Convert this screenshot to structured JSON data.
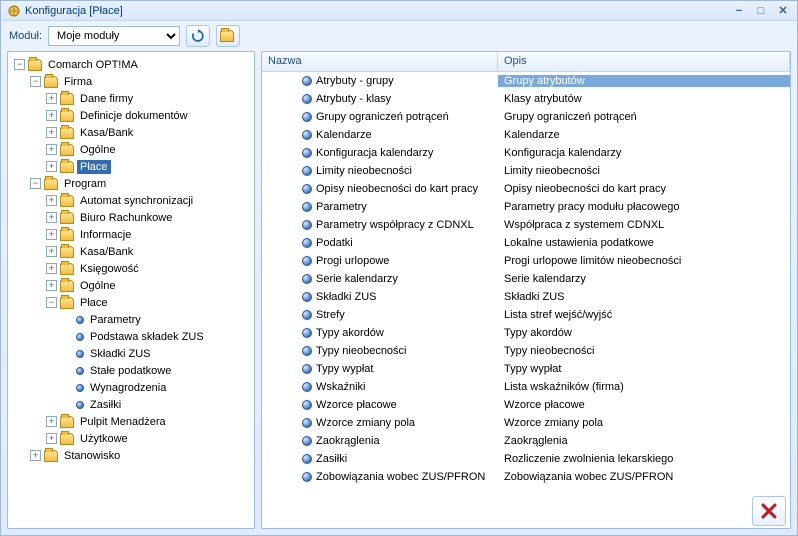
{
  "window": {
    "title": "Konfiguracja [Płace]"
  },
  "toolbar": {
    "module_label": "Moduł:",
    "module_value": "Moje moduły"
  },
  "tree": {
    "root_label": "Comarch OPT!MA",
    "firma_label": "Firma",
    "firma_children": [
      "Dane firmy",
      "Definicje dokumentów",
      "Kasa/Bank",
      "Ogólne",
      "Płace"
    ],
    "program_label": "Program",
    "program_children_before_place": [
      "Automat synchronizacji",
      "Biuro Rachunkowe",
      "Informacje",
      "Kasa/Bank",
      "Księgowość",
      "Ogólne"
    ],
    "place_label": "Płace",
    "place_children": [
      "Parametry",
      "Podstawa składek ZUS",
      "Składki ZUS",
      "Stałe podatkowe",
      "Wynagrodzenia",
      "Zasiłki"
    ],
    "program_children_after_place": [
      "Pulpit Menadżera",
      "Użytkowe"
    ],
    "stanowisko_label": "Stanowisko"
  },
  "list": {
    "col_name": "Nazwa",
    "col_desc": "Opis",
    "rows": [
      {
        "name": "Atrybuty - grupy",
        "desc": "Grupy atrybutów",
        "selected": true
      },
      {
        "name": "Atrybuty - klasy",
        "desc": "Klasy atrybutów"
      },
      {
        "name": "Grupy ograniczeń potrąceń",
        "desc": "Grupy ograniczeń potrąceń"
      },
      {
        "name": "Kalendarze",
        "desc": "Kalendarze"
      },
      {
        "name": "Konfiguracja kalendarzy",
        "desc": "Konfiguracja kalendarzy"
      },
      {
        "name": "Limity nieobecności",
        "desc": "Limity nieobecności"
      },
      {
        "name": "Opisy nieobecności do kart pracy",
        "desc": "Opisy nieobecności do kart pracy"
      },
      {
        "name": "Parametry",
        "desc": "Parametry pracy modułu płacowego"
      },
      {
        "name": "Parametry współpracy z CDNXL",
        "desc": "Współpraca z systemem CDNXL"
      },
      {
        "name": "Podatki",
        "desc": "Lokalne ustawienia podatkowe"
      },
      {
        "name": "Progi urlopowe",
        "desc": "Progi urlopowe limitów nieobecności"
      },
      {
        "name": "Serie kalendarzy",
        "desc": "Serie kalendarzy"
      },
      {
        "name": "Składki ZUS",
        "desc": "Składki ZUS"
      },
      {
        "name": "Strefy",
        "desc": "Lista stref wejść/wyjść"
      },
      {
        "name": "Typy akordów",
        "desc": "Typy akordów"
      },
      {
        "name": "Typy nieobecności",
        "desc": "Typy nieobecności"
      },
      {
        "name": "Typy wypłat",
        "desc": "Typy wypłat"
      },
      {
        "name": "Wskaźniki",
        "desc": "Lista wskaźników (firma)"
      },
      {
        "name": "Wzorce płacowe",
        "desc": "Wzorce płacowe"
      },
      {
        "name": "Wzorce zmiany pola",
        "desc": "Wzorce zmiany pola"
      },
      {
        "name": "Zaokrąglenia",
        "desc": "Zaokrąglenia"
      },
      {
        "name": "Zasiłki",
        "desc": "Rozliczenie zwolnienia lekarskiego"
      },
      {
        "name": "Zobowiązania wobec ZUS/PFRON",
        "desc": "Zobowiązania wobec ZUS/PFRON"
      }
    ]
  }
}
